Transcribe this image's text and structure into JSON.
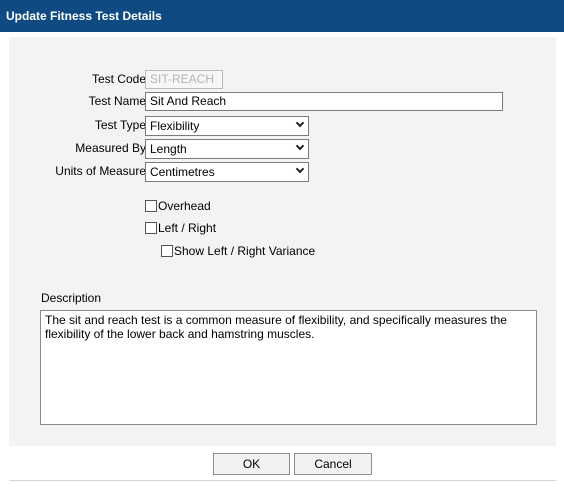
{
  "window": {
    "title": "Update Fitness Test Details"
  },
  "form": {
    "test_code": {
      "label": "Test Code",
      "value": "SIT-REACH"
    },
    "test_name": {
      "label": "Test Name",
      "value": "Sit And Reach"
    },
    "test_type": {
      "label": "Test Type",
      "value": "Flexibility"
    },
    "measured_by": {
      "label": "Measured By",
      "value": "Length"
    },
    "units": {
      "label": "Units of Measure",
      "value": "Centimetres"
    },
    "checkboxes": {
      "overhead": {
        "label": "Overhead",
        "checked": false
      },
      "left_right": {
        "label": "Left / Right",
        "checked": false
      },
      "variance": {
        "label": "Show Left / Right Variance",
        "checked": false
      }
    },
    "description": {
      "label": "Description",
      "value": "The sit and reach test is a common measure of flexibility, and specifically measures the flexibility of the lower back and hamstring muscles."
    }
  },
  "buttons": {
    "ok": "OK",
    "cancel": "Cancel"
  },
  "colors": {
    "titlebar": "#0f4a82",
    "panel": "#f3f3f3"
  }
}
